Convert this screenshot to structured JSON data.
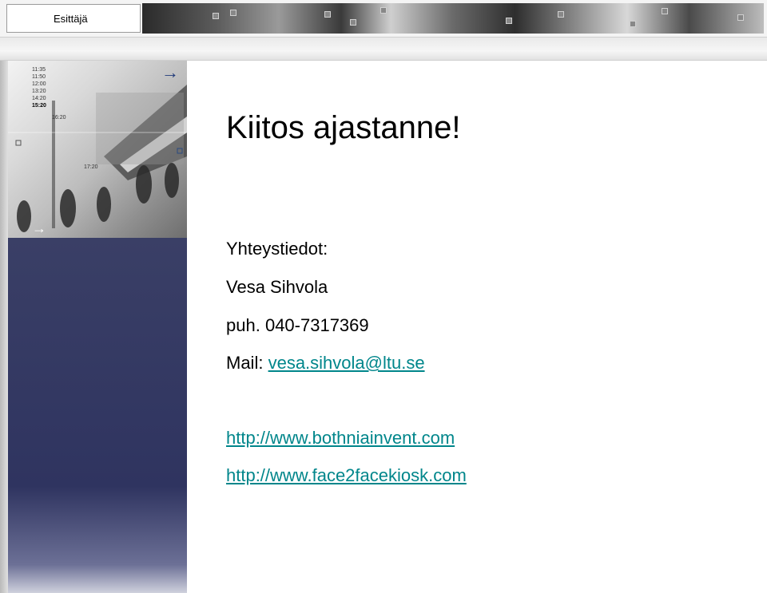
{
  "header": {
    "presenter_label": "Esittäjä"
  },
  "slide": {
    "title": "Kiitos ajastanne!",
    "contact_heading": "Yhteystiedot:",
    "name": "Vesa Sihvola",
    "phone_prefix": "puh.",
    "phone_number": "040-7317369",
    "mail_prefix": "Mail:",
    "email": "vesa.sihvola@ltu.se",
    "link_1": "http://www.bothniainvent.com",
    "link_2": "http://www.face2facekiosk.com"
  },
  "image": {
    "times": [
      "11:35",
      "11:50",
      "12:00",
      "13:20",
      "14:20",
      "15:20",
      "16:20",
      "17:20"
    ],
    "icons": [
      "arrow-right-icon",
      "arrow-right-icon"
    ]
  },
  "colors": {
    "link": "#00868b",
    "panel": "#2f3460"
  }
}
